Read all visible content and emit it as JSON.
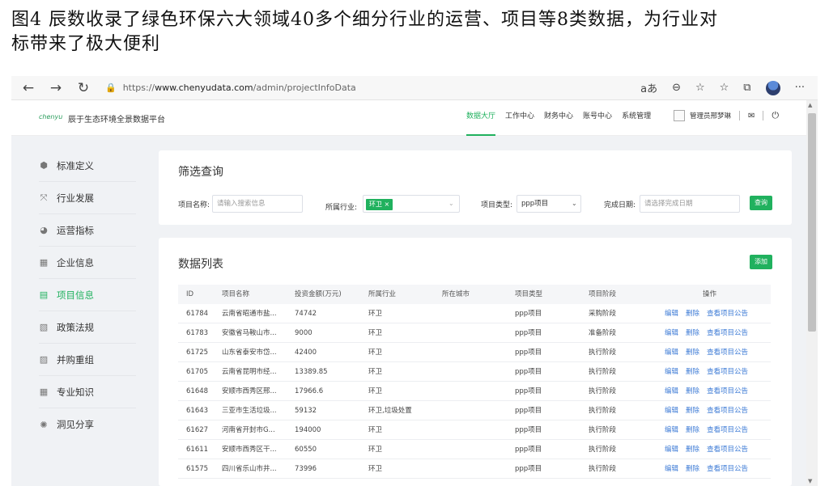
{
  "caption": {
    "line1": "图4 辰数收录了绿色环保六大领域40多个细分行业的运营、项目等8类数据，为行业对",
    "line2": "标带来了极大便利"
  },
  "browser": {
    "back": "←",
    "forward": "→",
    "refresh": "↻",
    "lock": "🔒",
    "url_prefix": "https://",
    "url_host": "www.chenyudata.com",
    "url_path": "/admin/projectInfoData",
    "read_aloud": "aあ",
    "zoom": "⊖",
    "favorite": "☆",
    "favorites": "☆",
    "collections": "⧉",
    "more": "···"
  },
  "app": {
    "logo_text": "chenyu",
    "brand": "辰于生态环境全景数据平台",
    "menu": [
      "数据大厅",
      "工作中心",
      "财务中心",
      "账号中心",
      "系统管理"
    ],
    "active_menu": 0,
    "user_name": "管理员邢梦琳",
    "mail_icon": "✉",
    "power_icon": "⏻"
  },
  "sidebar": {
    "items": [
      {
        "label": "标准定义",
        "icon": "⬢",
        "icon_name": "cube-icon"
      },
      {
        "label": "行业发展",
        "icon": "⤧",
        "icon_name": "arrows-icon"
      },
      {
        "label": "运营指标",
        "icon": "◕",
        "icon_name": "pie-chart-icon"
      },
      {
        "label": "企业信息",
        "icon": "▦",
        "icon_name": "building-icon"
      },
      {
        "label": "项目信息",
        "icon": "▤",
        "icon_name": "folder-icon"
      },
      {
        "label": "政策法规",
        "icon": "▧",
        "icon_name": "document-icon"
      },
      {
        "label": "并购重组",
        "icon": "▨",
        "icon_name": "merge-icon"
      },
      {
        "label": "专业知识",
        "icon": "▦",
        "icon_name": "grid-icon"
      },
      {
        "label": "洞见分享",
        "icon": "✺",
        "icon_name": "share-icon"
      }
    ],
    "active_index": 4
  },
  "filter": {
    "title": "筛选查询",
    "name_label": "项目名称:",
    "name_placeholder": "请输入搜索信息",
    "industry_label": "所属行业:",
    "industry_tag": "环卫",
    "tag_close": "×",
    "type_label": "项目类型:",
    "type_value": "ppp项目",
    "date_label": "完成日期:",
    "date_placeholder": "请选择完成日期",
    "query_button": "查询"
  },
  "list": {
    "title": "数据列表",
    "add_button": "添加",
    "columns": [
      "ID",
      "项目名称",
      "投资金额(万元)",
      "所属行业",
      "所在城市",
      "项目类型",
      "项目阶段",
      "操作"
    ],
    "ops": [
      "编辑",
      "删除",
      "查看项目公告"
    ],
    "rows": [
      {
        "id": "61784",
        "name": "云南省昭通市盐...",
        "amount": "74742",
        "industry": "环卫",
        "city": "",
        "type": "ppp项目",
        "stage": "采购阶段"
      },
      {
        "id": "61783",
        "name": "安徽省马鞍山市...",
        "amount": "9000",
        "industry": "环卫",
        "city": "",
        "type": "ppp项目",
        "stage": "准备阶段"
      },
      {
        "id": "61725",
        "name": "山东省泰安市岱...",
        "amount": "42400",
        "industry": "环卫",
        "city": "",
        "type": "ppp项目",
        "stage": "执行阶段"
      },
      {
        "id": "61705",
        "name": "云南省昆明市经...",
        "amount": "13389.85",
        "industry": "环卫",
        "city": "",
        "type": "ppp项目",
        "stage": "执行阶段"
      },
      {
        "id": "61648",
        "name": "安顺市西秀区邢...",
        "amount": "17966.6",
        "industry": "环卫",
        "city": "",
        "type": "ppp项目",
        "stage": "执行阶段"
      },
      {
        "id": "61643",
        "name": "三亚市生活垃圾...",
        "amount": "59132",
        "industry": "环卫,垃圾处置",
        "city": "",
        "type": "ppp项目",
        "stage": "执行阶段"
      },
      {
        "id": "61627",
        "name": "河南省开封市G...",
        "amount": "194000",
        "industry": "环卫",
        "city": "",
        "type": "ppp项目",
        "stage": "执行阶段"
      },
      {
        "id": "61611",
        "name": "安顺市西秀区干...",
        "amount": "60550",
        "industry": "环卫",
        "city": "",
        "type": "ppp项目",
        "stage": "执行阶段"
      },
      {
        "id": "61575",
        "name": "四川省乐山市井...",
        "amount": "73996",
        "industry": "环卫",
        "city": "",
        "type": "ppp项目",
        "stage": "执行阶段"
      }
    ]
  },
  "colors": {
    "accent": "#20b15e",
    "link": "#3d7bd6",
    "background": "#f0f2f5"
  }
}
